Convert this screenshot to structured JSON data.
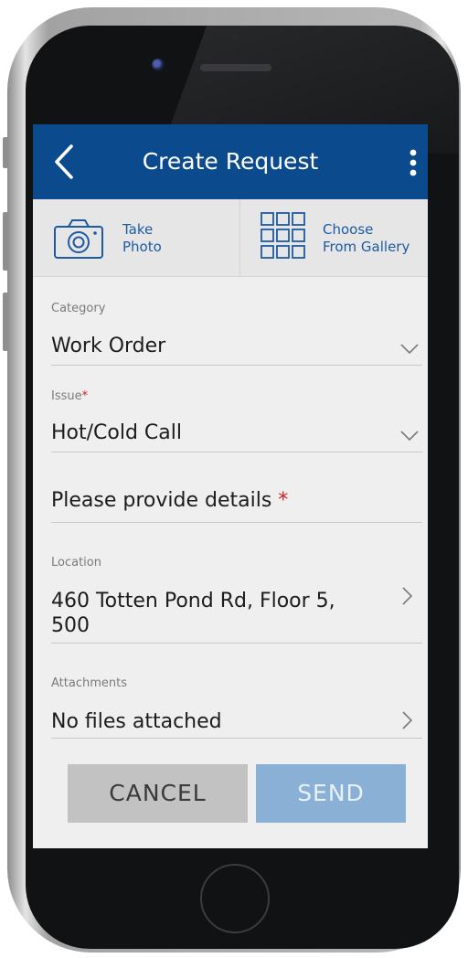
{
  "header": {
    "title": "Create Request"
  },
  "photo_actions": {
    "take_line1": "Take",
    "take_line2": "Photo",
    "gallery_line1": "Choose",
    "gallery_line2": "From Gallery"
  },
  "form": {
    "category": {
      "label": "Category",
      "value": "Work Order"
    },
    "issue": {
      "label": "Issue",
      "required_mark": "*",
      "value": "Hot/Cold Call"
    },
    "details": {
      "placeholder": "Please provide details",
      "required_mark": "*"
    },
    "location": {
      "label": "Location",
      "value_line1": "460 Totten Pond Rd, Floor 5,",
      "value_line2": "500"
    },
    "attachments": {
      "label": "Attachments",
      "value": "No files attached"
    }
  },
  "actions": {
    "cancel_label": "CANCEL",
    "send_label": "SEND"
  },
  "icons": {
    "back": "chevron-left-icon",
    "more": "more-vertical-icon",
    "camera": "camera-icon",
    "gallery": "grid-icon",
    "dropdown": "chevron-down-icon",
    "navigate": "chevron-right-icon"
  },
  "colors": {
    "app_bar": "#0c4a8e",
    "accent_text": "#1e5aa0",
    "required": "#d41e1e",
    "cancel_bg": "#c2c2c2",
    "send_bg": "#8ab0d6"
  }
}
